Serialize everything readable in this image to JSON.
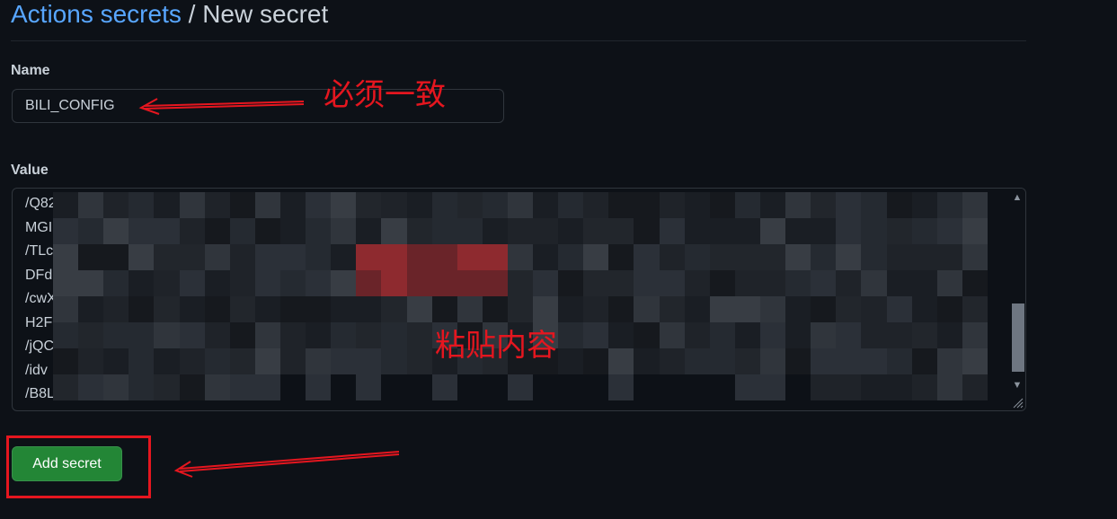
{
  "breadcrumb": {
    "link": "Actions secrets",
    "separator": " / ",
    "current": "New secret"
  },
  "name_field": {
    "label": "Name",
    "value": "BILI_CONFIG"
  },
  "value_field": {
    "label": "Value",
    "lines": [
      "/Q82Tu9m57u9sOBgnCQlDSnoH17XpxJp4eXNOeex9soEavppuZ+3Lvr",
      "MGI",
      "/TLc",
      "DFdMo",
      "/cwXPv",
      "H2F+8E",
      "/jQCl  Plld  2O  7  Wu  KT12O",
      "/idv",
      "/B8LebOAkAAA=="
    ],
    "redacted": true
  },
  "actions": {
    "add_label": "Add secret"
  },
  "annotations": {
    "name_note": "必须一致",
    "value_note": "粘贴内容",
    "color": "#e5161f"
  },
  "colors": {
    "background": "#0d1117",
    "link": "#58a6ff",
    "primary_button": "#238636",
    "border": "#30363d"
  }
}
